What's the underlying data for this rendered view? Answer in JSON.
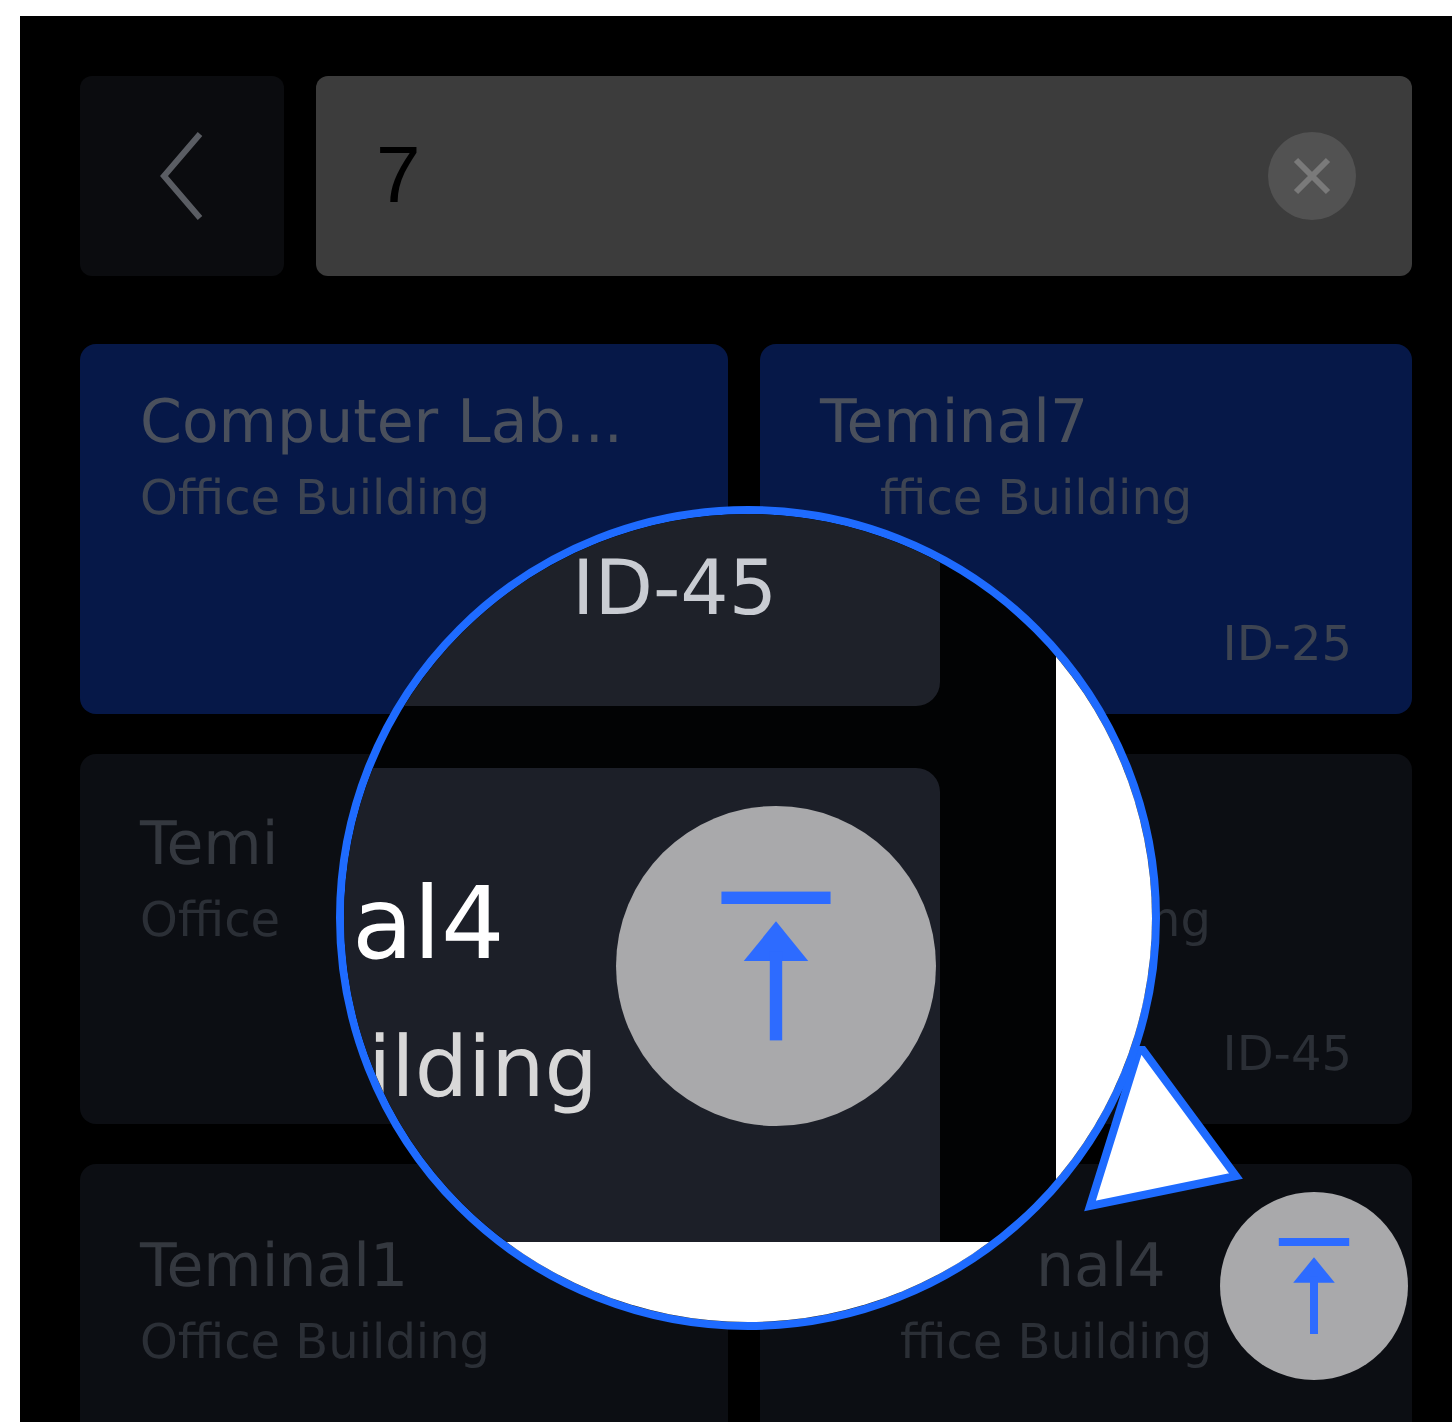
{
  "search": {
    "value": "7"
  },
  "cards": [
    {
      "title": "Computer Lab...",
      "subtitle": "Office Building",
      "selected": true
    },
    {
      "title": "Teminal7",
      "subtitle": "ffice Building",
      "id": "ID-25",
      "selected": true
    },
    {
      "title": "Temi",
      "subtitle": "Office",
      "selected": false
    },
    {
      "subtitle": "ng",
      "id": "ID-45",
      "selected": false
    },
    {
      "title": "Teminal1",
      "subtitle": "Office Building",
      "selected": false
    },
    {
      "title": "nal4",
      "subtitle": "ffice Building",
      "selected": false
    }
  ],
  "magnifier": {
    "id": "ID-45",
    "title": "al4",
    "subtitle": "ilding"
  }
}
